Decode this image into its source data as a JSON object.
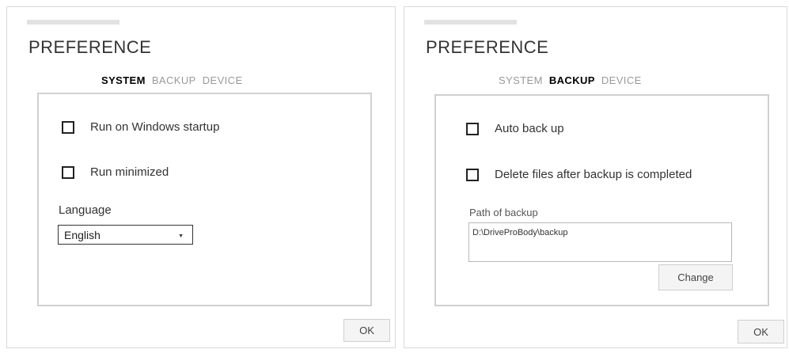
{
  "left": {
    "title": "PREFERENCE",
    "tabs": [
      {
        "label": "SYSTEM",
        "active": true
      },
      {
        "label": "BACKUP",
        "active": false
      },
      {
        "label": "DEVICE",
        "active": false
      }
    ],
    "options": [
      {
        "label": "Run on Windows startup",
        "checked": false
      },
      {
        "label": "Run minimized",
        "checked": false
      }
    ],
    "language_label": "Language",
    "language_value": "English",
    "ok_label": "OK"
  },
  "right": {
    "title": "PREFERENCE",
    "tabs": [
      {
        "label": "SYSTEM",
        "active": false
      },
      {
        "label": "BACKUP",
        "active": true
      },
      {
        "label": "DEVICE",
        "active": false
      }
    ],
    "options": [
      {
        "label": "Auto back up",
        "checked": false
      },
      {
        "label": "Delete files after backup is completed",
        "checked": false
      }
    ],
    "path_label": "Path of backup",
    "path_value": "D:\\DriveProBody\\backup",
    "change_label": "Change",
    "ok_label": "OK"
  },
  "icons": {
    "dropdown_caret": "chevron-down-icon"
  },
  "colors": {
    "border": "#d0d0d0",
    "active_tab": "#000000",
    "inactive_tab": "#9a9a9a"
  }
}
